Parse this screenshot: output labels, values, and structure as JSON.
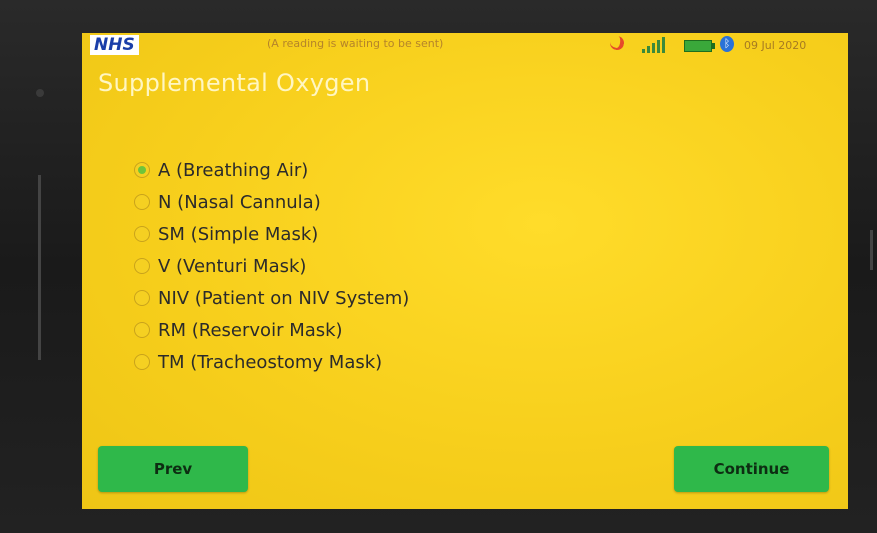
{
  "status_bar": {
    "logo": "NHS",
    "message": "(A reading is waiting to be sent)",
    "date": "09 Jul 2020",
    "icons": [
      "do-not-disturb-icon",
      "signal-icon",
      "battery-icon",
      "bluetooth-icon"
    ],
    "bluetooth_glyph": "ᛒ"
  },
  "page": {
    "title": "Supplemental Oxygen"
  },
  "options": [
    {
      "label": "A (Breathing Air)",
      "selected": true
    },
    {
      "label": "N (Nasal Cannula)",
      "selected": false
    },
    {
      "label": "SM (Simple Mask)",
      "selected": false
    },
    {
      "label": "V (Venturi Mask)",
      "selected": false
    },
    {
      "label": "NIV (Patient on NIV System)",
      "selected": false
    },
    {
      "label": "RM (Reservoir Mask)",
      "selected": false
    },
    {
      "label": "TM (Tracheostomy Mask)",
      "selected": false
    }
  ],
  "buttons": {
    "prev": "Prev",
    "continue": "Continue"
  },
  "colors": {
    "screen_background": "#f7cf1c",
    "button_green": "#2fb84a",
    "nhs_blue": "#1a3ea8",
    "selected_radio": "#6fc43a"
  }
}
